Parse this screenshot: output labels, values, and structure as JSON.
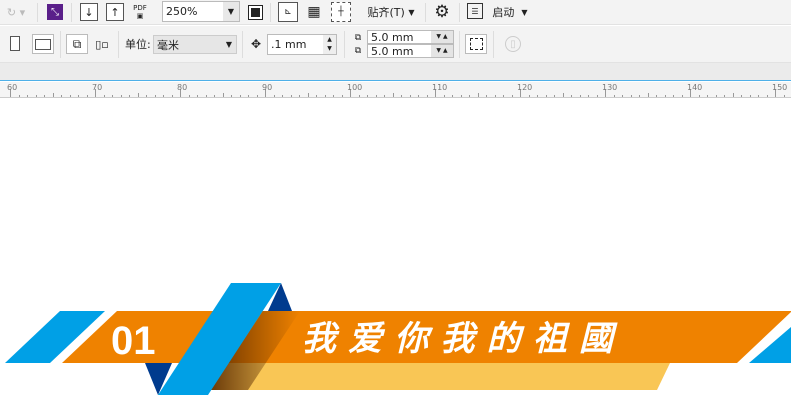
{
  "toolbar1": {
    "zoom_value": "250%",
    "pdf_label": "PDF",
    "snap_label": "贴齐(T)",
    "launch_label": "启动",
    "icons": [
      "redo-icon",
      "color-icon",
      "import-icon",
      "export-icon",
      "publish-pdf-icon",
      "full-screen-icon",
      "rulers-icon",
      "grid-icon",
      "guidelines-icon",
      "gear-icon",
      "launch-icon"
    ]
  },
  "toolbar2": {
    "units_label": "单位:",
    "units_value": "毫米",
    "nudge_value": ".1 mm",
    "dup_x": "5.0 mm",
    "dup_y": "5.0 mm",
    "icons": [
      "portrait-icon",
      "landscape-icon",
      "all-pages-icon",
      "current-page-icon",
      "nudge-icon",
      "duplicate-distance-icon",
      "treat-as-filled-icon",
      "edit-bitmap-icon"
    ]
  },
  "ruler": {
    "labels": [
      "60",
      "70",
      "80",
      "90",
      "100",
      "110",
      "120",
      "130",
      "140",
      "150"
    ]
  },
  "canvas": {
    "number": "01",
    "title": "我爱你我的祖國",
    "colors": {
      "orange": "#ef8200",
      "blue": "#00a0e6",
      "dark_blue": "#003b8e",
      "yellow": "#f9c655"
    }
  }
}
